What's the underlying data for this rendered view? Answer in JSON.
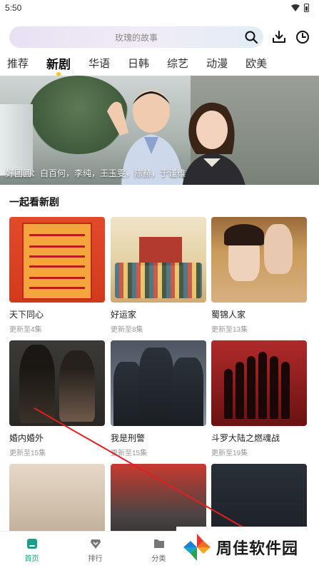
{
  "status_bar": {
    "time": "5:50"
  },
  "search": {
    "placeholder": "玫瑰的故事"
  },
  "tabs": [
    {
      "label": "推荐",
      "active": false
    },
    {
      "label": "新剧",
      "active": true
    },
    {
      "label": "华语",
      "active": false
    },
    {
      "label": "日韩",
      "active": false
    },
    {
      "label": "综艺",
      "active": false
    },
    {
      "label": "动漫",
      "active": false
    },
    {
      "label": "欧美",
      "active": false
    }
  ],
  "banner": {
    "caption": "好团圆：白百何，李纯，王玉雯，陈赫，于谨维"
  },
  "section": {
    "title": "一起看新剧"
  },
  "shows": [
    {
      "title": "天下同心",
      "update": "更新至4集"
    },
    {
      "title": "好运家",
      "update": "更新至8集"
    },
    {
      "title": "蜀锦人家",
      "update": "更新至13集"
    },
    {
      "title": "婚内婚外",
      "update": "更新至15集"
    },
    {
      "title": "我是刑警",
      "update": "更新至15集"
    },
    {
      "title": "斗罗大陆之燃魂战",
      "update": "更新至19集"
    },
    {
      "title": "",
      "update": ""
    },
    {
      "title": "",
      "update": ""
    },
    {
      "title": "",
      "update": ""
    }
  ],
  "bottom_nav": [
    {
      "label": "首页",
      "icon": "home-icon",
      "active": true
    },
    {
      "label": "排行",
      "icon": "ranking-icon",
      "active": false
    },
    {
      "label": "分类",
      "icon": "category-icon",
      "active": false
    }
  ],
  "watermark": {
    "text": "周佳软件园"
  },
  "colors": {
    "accent": "#1aa08a",
    "tab_dot": "#f5c518",
    "arrow": "#e02020"
  }
}
